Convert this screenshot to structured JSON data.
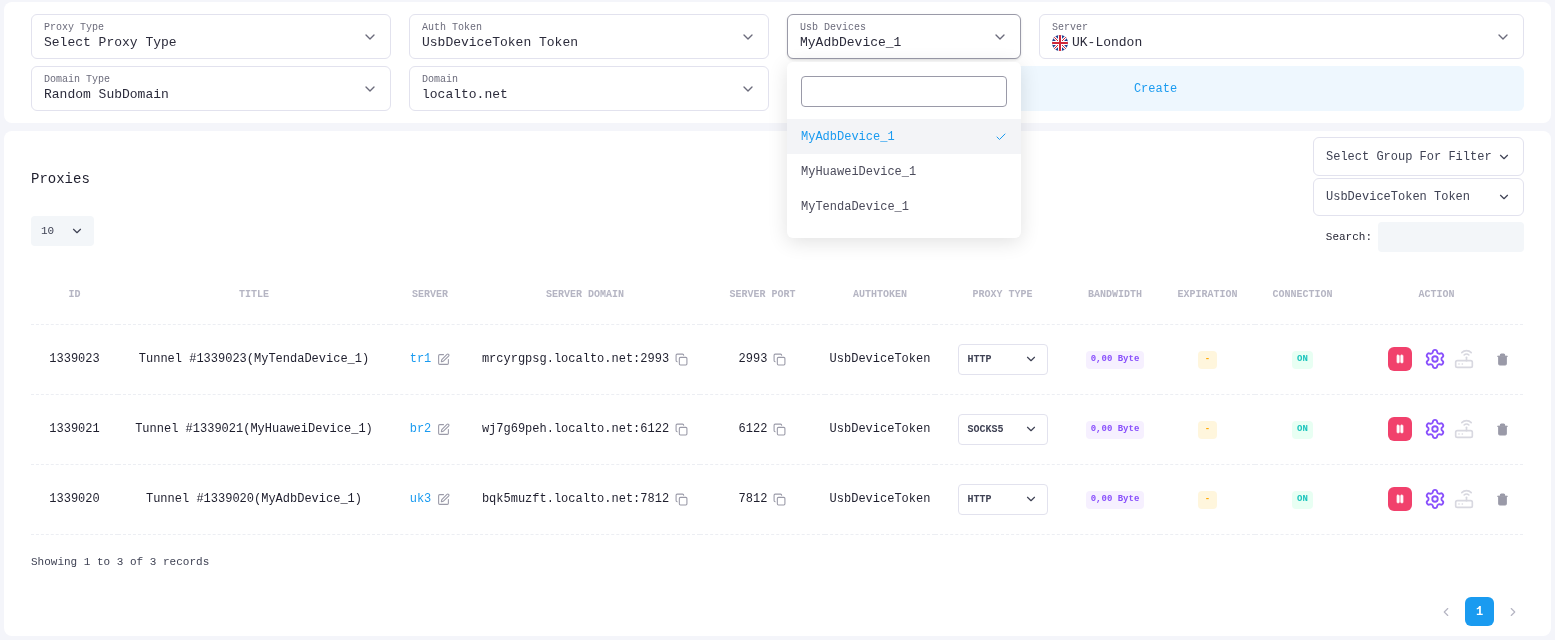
{
  "form": {
    "fields": [
      {
        "label": "Proxy Type",
        "value": "Select Proxy Type",
        "expanded": false
      },
      {
        "label": "Auth Token",
        "value": "UsbDeviceToken Token",
        "expanded": false
      },
      {
        "label": "Usb Devices",
        "value": "MyAdbDevice_1",
        "expanded": true,
        "options": [
          {
            "label": "MyAdbDevice_1",
            "selected": true
          },
          {
            "label": "MyHuaweiDevice_1",
            "selected": false
          },
          {
            "label": "MyTendaDevice_1",
            "selected": false
          }
        ]
      },
      {
        "label": "Server",
        "value": "UK-London",
        "expanded": false,
        "kind": "flag"
      },
      {
        "label": "Domain Type",
        "value": "Random SubDomain",
        "expanded": false
      },
      {
        "label": "Domain",
        "value": "localto.net",
        "expanded": false
      }
    ],
    "create_button": "Create"
  },
  "proxies": {
    "title": "Proxies",
    "group_filter": "Select Group For Filter",
    "token_filter": "UsbDeviceToken Token",
    "page_size": "10",
    "search_label": "Search:",
    "columns": [
      "ID",
      "TITLE",
      "SERVER",
      "SERVER DOMAIN",
      "SERVER PORT",
      "AUTHTOKEN",
      "PROXY TYPE",
      "BANDWIDTH",
      "EXPIRATION",
      "CONNECTION",
      "ACTION"
    ],
    "rows": [
      {
        "id": "1339023",
        "title": "Tunnel #1339023(MyTendaDevice_1)",
        "server": "tr1",
        "domain": "mrcyrgpsg.localto.net:2993",
        "port": "2993",
        "authtoken": "UsbDeviceToken",
        "proxy_type": "HTTP",
        "bandwidth": "0,00 Byte",
        "expiration": "-",
        "connection": "ON"
      },
      {
        "id": "1339021",
        "title": "Tunnel #1339021(MyHuaweiDevice_1)",
        "server": "br2",
        "domain": "wj7g69peh.localto.net:6122",
        "port": "6122",
        "authtoken": "UsbDeviceToken",
        "proxy_type": "SOCKS5",
        "bandwidth": "0,00 Byte",
        "expiration": "-",
        "connection": "ON"
      },
      {
        "id": "1339020",
        "title": "Tunnel #1339020(MyAdbDevice_1)",
        "server": "uk3",
        "domain": "bqk5muzft.localto.net:7812",
        "port": "7812",
        "authtoken": "UsbDeviceToken",
        "proxy_type": "HTTP",
        "bandwidth": "0,00 Byte",
        "expiration": "-",
        "connection": "ON"
      }
    ],
    "info": "Showing 1 to 3 of 3 records",
    "pages": [
      {
        "label": "1",
        "selected": true
      }
    ]
  }
}
